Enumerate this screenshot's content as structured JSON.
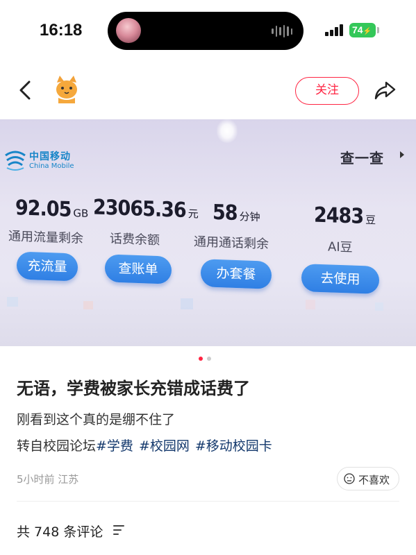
{
  "status_bar": {
    "time": "16:18",
    "battery": "74",
    "battery_color": "#34c759"
  },
  "nav": {
    "back_icon": "chevron-left-icon",
    "avatar_icon": "cat-avatar-icon",
    "follow_label": "关注",
    "share_icon": "share-arrow-icon",
    "accent": "#ff2442"
  },
  "photo": {
    "brand_cn": "中国移动",
    "brand_en": "China Mobile",
    "query_label": "查一查",
    "stats": [
      {
        "value": "92.05",
        "unit": "GB",
        "label": "通用流量剩余",
        "button": "充流量"
      },
      {
        "value": "23065.36",
        "unit": "元",
        "label": "话费余额",
        "button": "查账单"
      },
      {
        "value": "58",
        "unit": "分钟",
        "label": "通用通话剩余",
        "button": "办套餐"
      },
      {
        "value": "2483",
        "unit": "豆",
        "label": "AI豆",
        "button": "去使用"
      }
    ],
    "button_color": "#2f7fe4"
  },
  "carousel": {
    "active_color": "#ff2442",
    "inactive_color": "#cccccc"
  },
  "post": {
    "title": "无语，学费被家长充错成话费了",
    "body": "刚看到这个真的是绷不住了",
    "prefix": "转自校园论坛",
    "tags": [
      "#学费",
      "#校园网",
      "#移动校园卡"
    ],
    "meta": "5小时前 江苏",
    "dislike_label": "不喜欢",
    "comments": "共 748 条评论"
  }
}
